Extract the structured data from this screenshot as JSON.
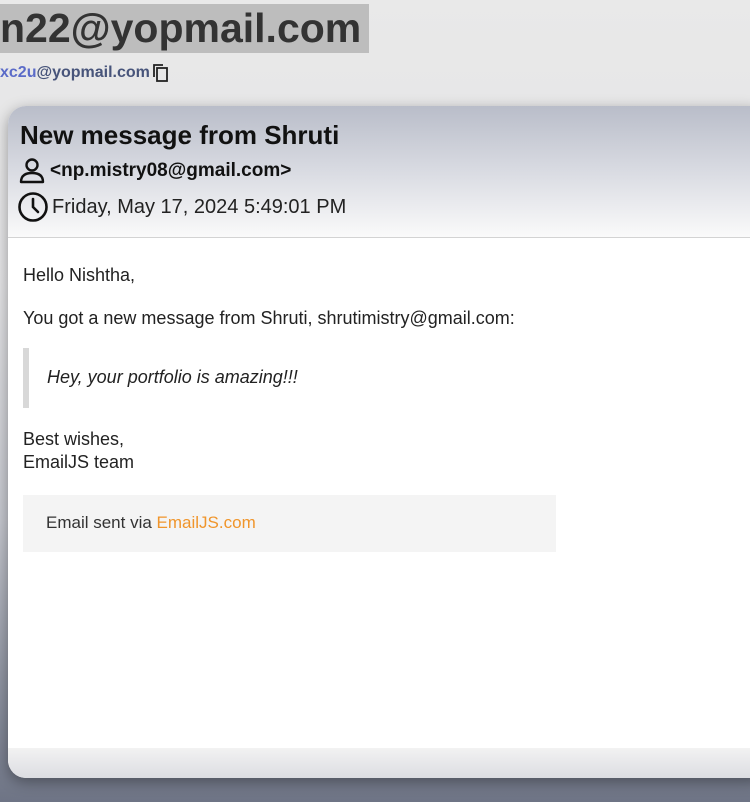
{
  "inbox": {
    "address": "n22@yopmail.com",
    "alt_prefix": "xc2u",
    "alt_domain": "@yopmail.com",
    "copy_icon": "copy-icon"
  },
  "email": {
    "subject": "New message from Shruti",
    "from": "<np.mistry08@gmail.com>",
    "date": "Friday, May 17, 2024 5:49:01 PM",
    "sender_icon": "person-icon",
    "date_icon": "clock-icon",
    "greeting": "Hello Nishtha,",
    "intro": "You got a new message from Shruti, shrutimistry@gmail.com:",
    "quote": "Hey, your portfolio is amazing!!!",
    "signoff_line1": "Best wishes,",
    "signoff_line2": "EmailJS team",
    "footer_prefix": "Email sent via ",
    "footer_link": "EmailJS.com"
  },
  "colors": {
    "accent_link": "#f0952b",
    "alt_prefix": "#5b6bc8",
    "alt_domain": "#47547a"
  }
}
